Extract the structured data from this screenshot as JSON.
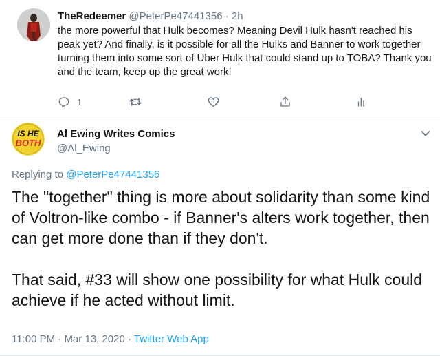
{
  "reply_tweet": {
    "display_name": "TheRedeemer",
    "handle": "@PeterPe47441356",
    "separator": "·",
    "time": "2h",
    "text": "the more powerful that Hulk becomes? Meaning Devil Hulk hasn't reached his peak yet? And finally, is it possible for all the Hulks and Banner to work together turning them into some sort of Uber Hulk that could stand up to TOBA? Thank you and the team, keep up the great work!",
    "actions": {
      "reply_icon": "reply-icon",
      "reply_count": "1",
      "retweet_icon": "retweet-icon",
      "like_icon": "heart-icon",
      "share_icon": "share-icon",
      "analytics_icon": "analytics-icon"
    }
  },
  "main_tweet": {
    "display_name": "Al Ewing Writes Comics",
    "handle": "@Al_Ewing",
    "avatar_badge_line1": "IS HE",
    "avatar_badge_line2": "BOTH",
    "replying_prefix": "Replying to",
    "replying_to": "@PeterPe47441356",
    "text_paragraph_1": "The \"together\" thing is more about solidarity than some kind of Voltron-like combo - if Banner's alters work together, then can get more done than if they don't.",
    "text_paragraph_2": "That said, #33 will show one possibility for what Hulk could achieve if he acted without limit.",
    "time": "11:00 PM",
    "separator": "·",
    "date": "Mar 13, 2020",
    "source": "Twitter Web App"
  },
  "colors": {
    "text": "#14171a",
    "secondary": "#657786",
    "link": "#1da1f2",
    "divider": "#e6ecf0",
    "badge_bg": "#f2d32c",
    "badge_text_dark": "#111111",
    "badge_text_red": "#d8261c"
  }
}
